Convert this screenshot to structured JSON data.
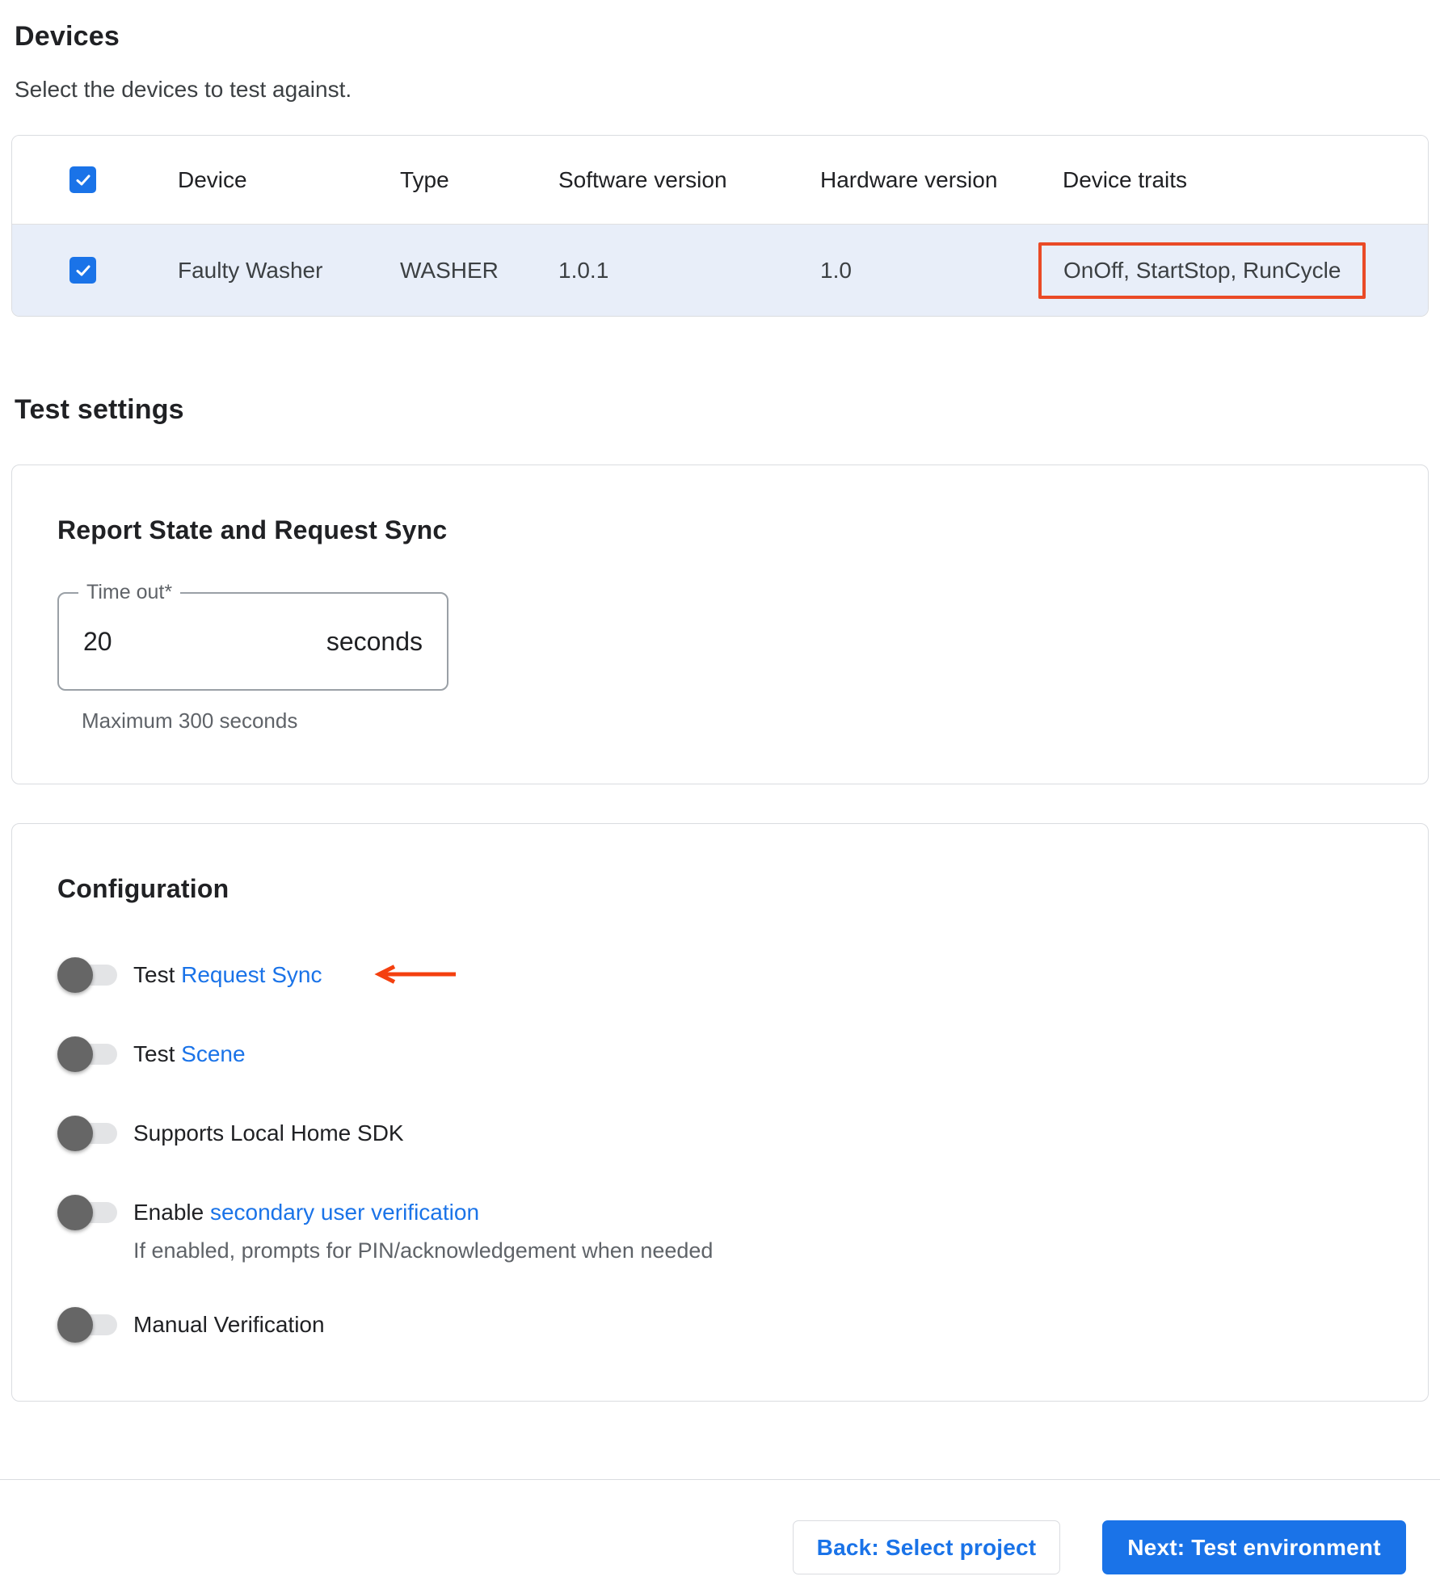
{
  "devices_section": {
    "title": "Devices",
    "subtitle": "Select the devices to test against.",
    "table": {
      "columns": [
        "Device",
        "Type",
        "Software version",
        "Hardware version",
        "Device traits"
      ],
      "header_checkbox_checked": true,
      "rows": [
        {
          "selected": true,
          "device": "Faulty Washer",
          "type": "WASHER",
          "software_version": "1.0.1",
          "hardware_version": "1.0",
          "device_traits": "OnOff, StartStop, RunCycle",
          "traits_highlighted": true
        }
      ]
    }
  },
  "test_settings_section": {
    "title": "Test settings",
    "report_card": {
      "title": "Report State and Request Sync",
      "timeout_field": {
        "label": "Time out*",
        "value": "20",
        "suffix": "seconds",
        "helper": "Maximum 300 seconds"
      }
    },
    "config_card": {
      "title": "Configuration",
      "toggles": [
        {
          "text": "Test ",
          "link": "Request Sync",
          "enabled": false,
          "has_arrow_annotation": true
        },
        {
          "text": "Test ",
          "link": "Scene",
          "enabled": false
        },
        {
          "text": "Supports Local Home SDK",
          "link": "",
          "enabled": false
        },
        {
          "text": "Enable ",
          "link": "secondary user verification",
          "enabled": false,
          "subtext": "If enabled, prompts for PIN/acknowledgement when needed"
        },
        {
          "text": "Manual Verification",
          "link": "",
          "enabled": false
        }
      ]
    }
  },
  "footer": {
    "back_label": "Back: Select project",
    "next_label": "Next: Test environment"
  },
  "colors": {
    "accent_blue": "#1a73e8",
    "row_highlight": "#e8eef9",
    "card_border": "#dadce0",
    "highlight_box_red": "#ea4a26",
    "arrow_red": "#f4400f",
    "toggle_knob": "#666666",
    "toggle_track": "#e3e4e6",
    "text_primary": "#202124",
    "text_secondary": "#5f6368"
  }
}
